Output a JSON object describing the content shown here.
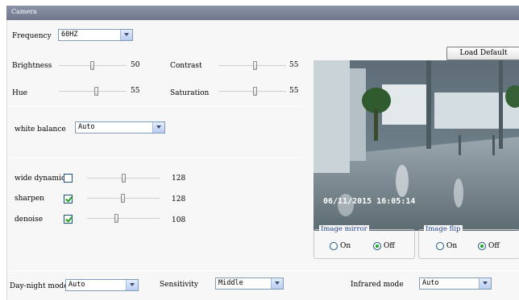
{
  "title": "Camera",
  "frequency": {
    "label": "Frequency",
    "value": "60HZ"
  },
  "sliders": [
    {
      "label": "Brightness",
      "value": "50",
      "level": 0.5
    },
    {
      "label": "Contrast",
      "value": "55",
      "level": 0.55
    },
    {
      "label": "Hue",
      "value": "55",
      "level": 0.55
    },
    {
      "label": "Saturation",
      "value": "55",
      "level": 0.55
    }
  ],
  "white_balance": {
    "label": "white balance",
    "value": "Auto"
  },
  "features": [
    {
      "label": "wide dynamic",
      "checked": false,
      "value": "128",
      "level": 0.5
    },
    {
      "label": "sharpen",
      "checked": true,
      "value": "128",
      "level": 0.5
    },
    {
      "label": "denoise",
      "checked": true,
      "value": "108",
      "level": 0.42
    }
  ],
  "load_default": "Load Default",
  "video": {
    "timestamp": "06/11/2015 16:05:14"
  },
  "image_mirror": {
    "legend": "Image mirror",
    "on": "On",
    "off": "Off",
    "selected": "off"
  },
  "image_flip": {
    "legend": "Image flip",
    "on": "On",
    "off": "Off",
    "selected": "off"
  },
  "bottom": {
    "day_night": {
      "label": "Day-night mode",
      "value": "Auto"
    },
    "sensitivity": {
      "label": "Sensitivity",
      "value": "Middle"
    },
    "infrared": {
      "label": "Infrared mode",
      "value": "Auto"
    }
  }
}
